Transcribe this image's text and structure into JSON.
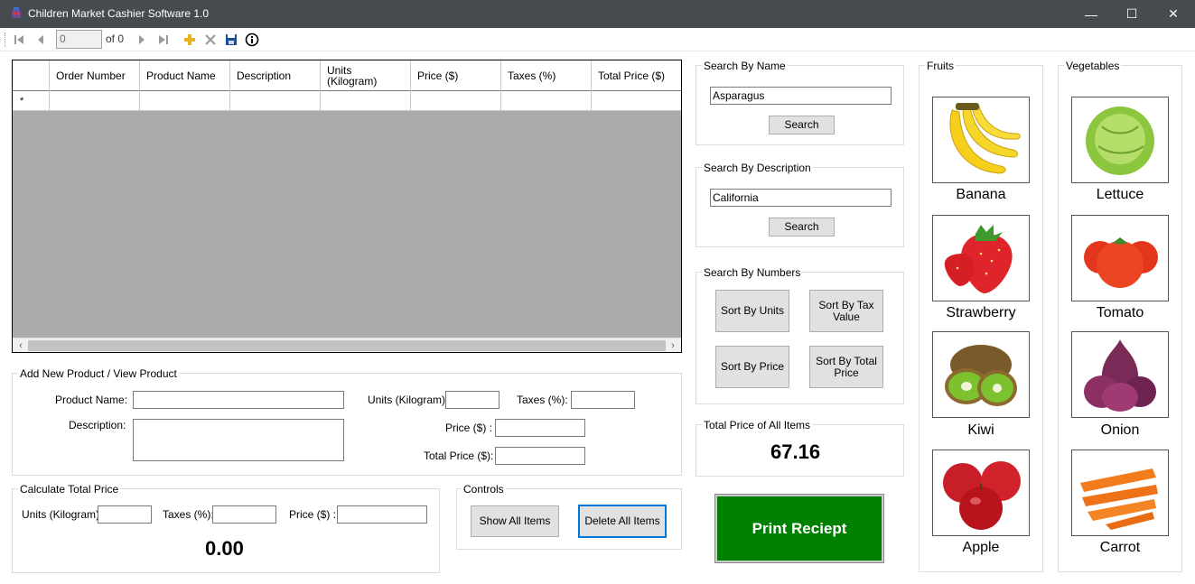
{
  "window": {
    "title": "Children Market Cashier Software 1.0",
    "minimize": "—",
    "maximize": "☐",
    "close": "✕"
  },
  "toolbar": {
    "position": "0",
    "count_label": "of 0"
  },
  "grid": {
    "columns": [
      "Order Number",
      "Product Name",
      "Description",
      "Units (Kilogram)",
      "Price ($)",
      "Taxes (%)",
      "Total Price ($)"
    ],
    "new_row_marker": "*"
  },
  "search_name": {
    "title": "Search By Name",
    "value": "Asparagus",
    "button": "Search"
  },
  "search_description": {
    "title": "Search By Description",
    "value": "California",
    "button": "Search"
  },
  "search_numbers": {
    "title": "Search By Numbers",
    "sort_units": "Sort By Units",
    "sort_tax": "Sort By Tax Value",
    "sort_price": "Sort By Price",
    "sort_total": "Sort By Total Price"
  },
  "total_all": {
    "title": "Total Price of All Items",
    "value": "67.16"
  },
  "print_button": "Print Reciept",
  "add_product": {
    "title": "Add New Product / View Product",
    "product_name_label": "Product Name:",
    "description_label": "Description:",
    "units_label": "Units (Kilogram):",
    "taxes_label": "Taxes (%):",
    "price_label": "Price ($) :",
    "total_price_label": "Total Price ($):"
  },
  "calculate": {
    "title": "Calculate Total Price",
    "units_label": "Units (Kilogram):",
    "taxes_label": "Taxes (%):",
    "price_label": "Price ($) :",
    "result": "0.00"
  },
  "controls": {
    "title": "Controls",
    "show_all": "Show All Items",
    "delete_all": "Delete All Items"
  },
  "fruits": {
    "title": "Fruits",
    "items": [
      "Banana",
      "Strawberry",
      "Kiwi",
      "Apple"
    ]
  },
  "vegetables": {
    "title": "Vegetables",
    "items": [
      "Lettuce",
      "Tomato",
      "Onion",
      "Carrot"
    ]
  },
  "colors": {
    "titlebar": "#464b4f",
    "print_button": "#008000",
    "grid_empty": "#ababab"
  }
}
